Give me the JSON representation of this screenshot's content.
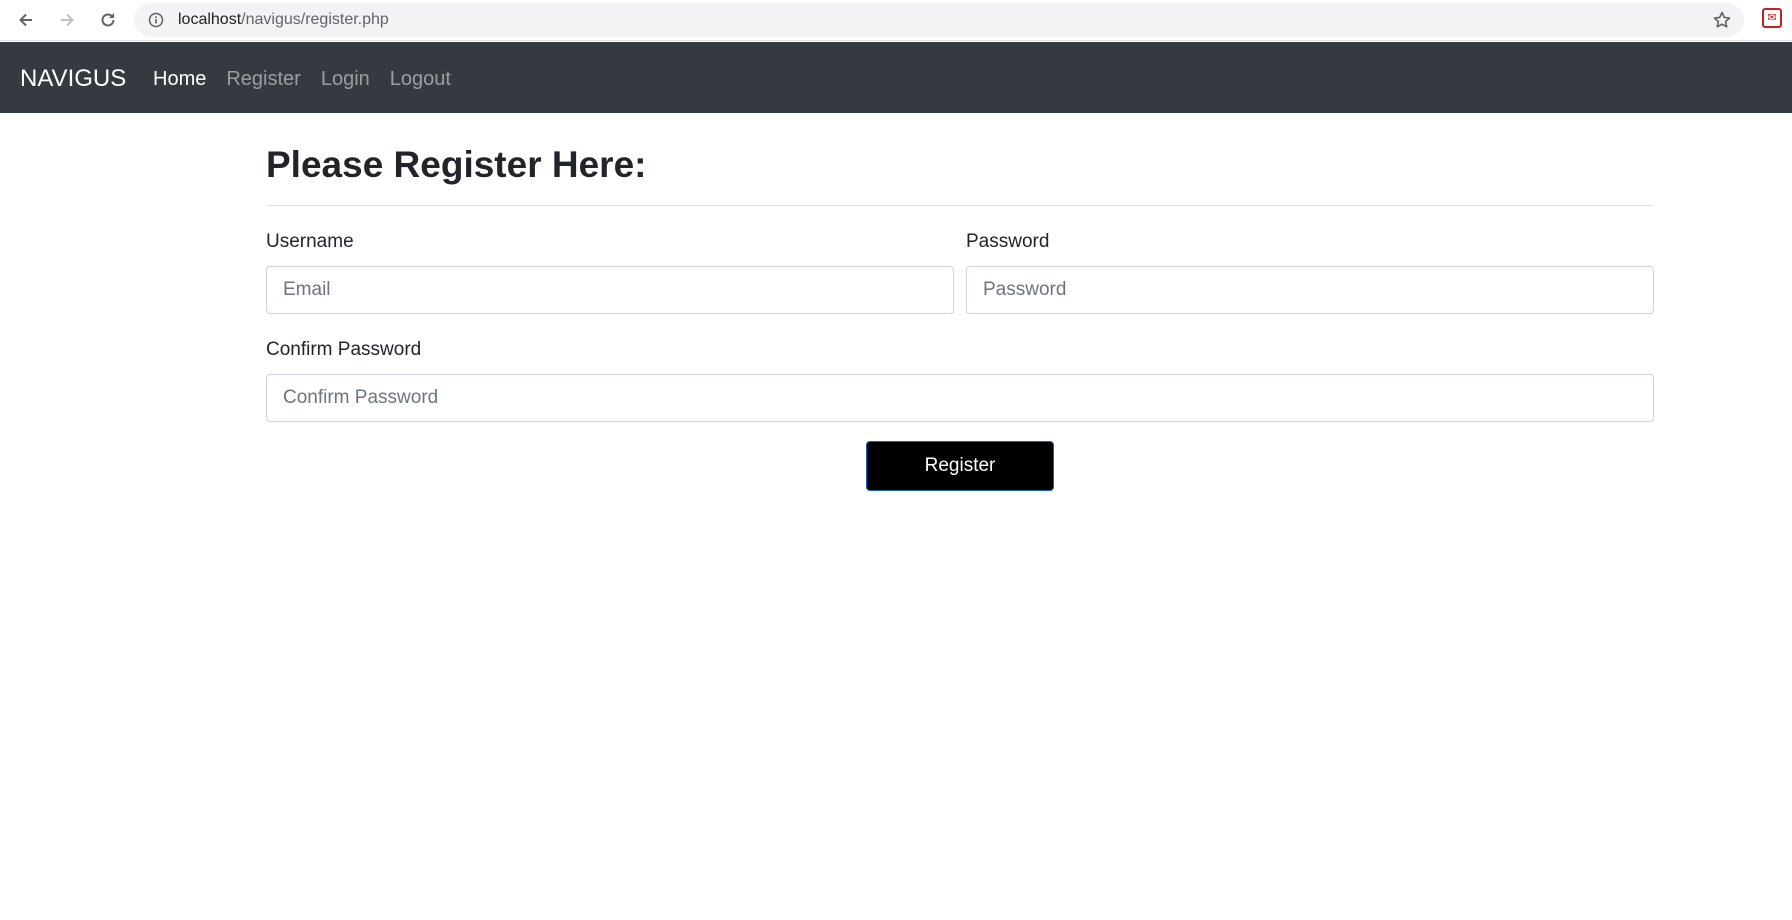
{
  "browser": {
    "url_host": "localhost",
    "url_path": "/navigus/register.php",
    "icons": {
      "back": "back-arrow-icon",
      "forward": "forward-arrow-icon",
      "reload": "reload-icon",
      "info": "info-icon",
      "bookmark": "star-icon",
      "extension": "extension-icon"
    }
  },
  "navbar": {
    "brand": "NAVIGUS",
    "links": [
      {
        "label": "Home",
        "active": true
      },
      {
        "label": "Register",
        "active": false
      },
      {
        "label": "Login",
        "active": false
      },
      {
        "label": "Logout",
        "active": false
      }
    ],
    "background": "#343a40"
  },
  "form": {
    "title": "Please Register Here:",
    "username": {
      "label": "Username",
      "placeholder": "Email",
      "value": ""
    },
    "password": {
      "label": "Password",
      "placeholder": "Password",
      "value": ""
    },
    "confirm": {
      "label": "Confirm Password",
      "placeholder": "Confirm Password",
      "value": ""
    },
    "submit_label": "Register",
    "submit_color": "#000000"
  }
}
